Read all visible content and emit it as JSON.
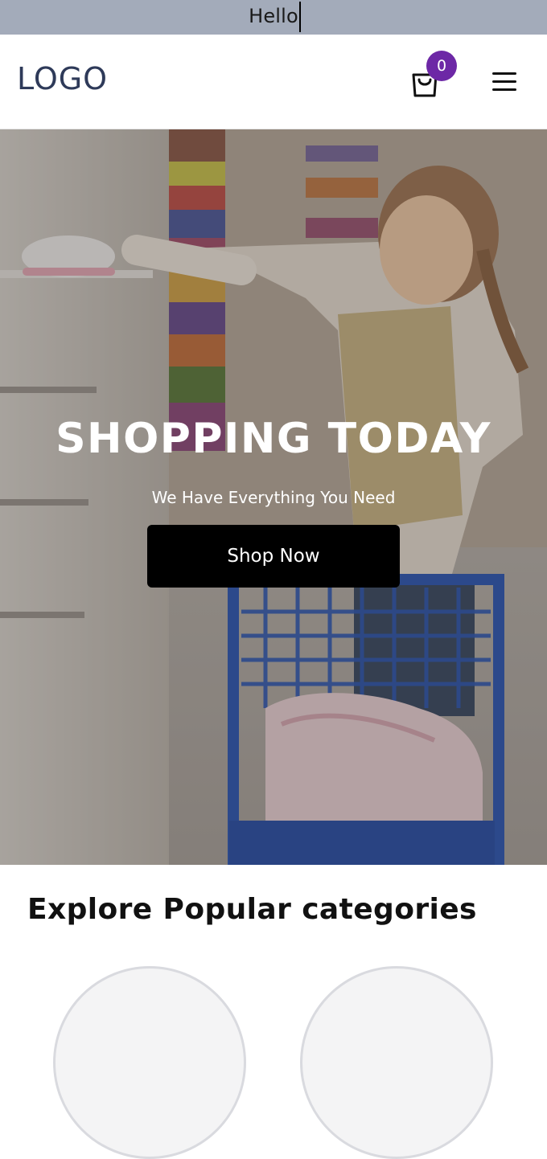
{
  "topbar": {
    "text": "Hello"
  },
  "header": {
    "logo": "LOGO",
    "cart_count": "0"
  },
  "hero": {
    "title": "SHOPPING TODAY",
    "subtitle": "We Have Everything You Need",
    "button_label": "Shop Now"
  },
  "categories": {
    "title": "Explore Popular categories"
  },
  "colors": {
    "topbar_bg": "#a3abba",
    "logo": "#2e3a59",
    "badge": "#6d28a6",
    "button_bg": "#000000"
  },
  "icons": [
    "cart-icon",
    "menu-icon"
  ]
}
